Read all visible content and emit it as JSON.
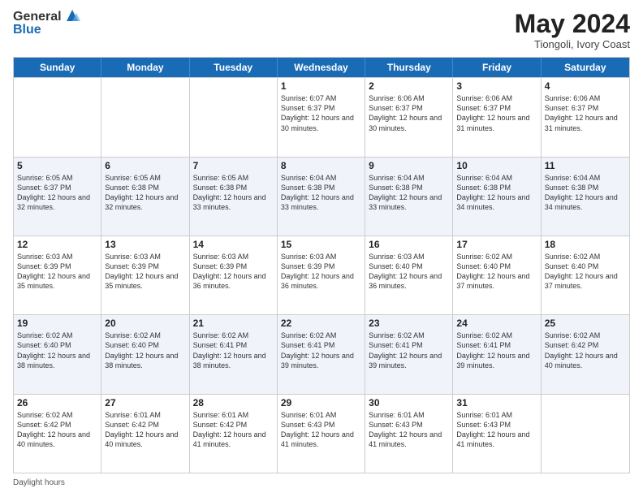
{
  "header": {
    "logo_general": "General",
    "logo_blue": "Blue",
    "month_year": "May 2024",
    "location": "Tiongoli, Ivory Coast"
  },
  "weekdays": [
    "Sunday",
    "Monday",
    "Tuesday",
    "Wednesday",
    "Thursday",
    "Friday",
    "Saturday"
  ],
  "rows": [
    [
      {
        "day": "",
        "sunrise": "",
        "sunset": "",
        "daylight": ""
      },
      {
        "day": "",
        "sunrise": "",
        "sunset": "",
        "daylight": ""
      },
      {
        "day": "",
        "sunrise": "",
        "sunset": "",
        "daylight": ""
      },
      {
        "day": "1",
        "sunrise": "Sunrise: 6:07 AM",
        "sunset": "Sunset: 6:37 PM",
        "daylight": "Daylight: 12 hours and 30 minutes."
      },
      {
        "day": "2",
        "sunrise": "Sunrise: 6:06 AM",
        "sunset": "Sunset: 6:37 PM",
        "daylight": "Daylight: 12 hours and 30 minutes."
      },
      {
        "day": "3",
        "sunrise": "Sunrise: 6:06 AM",
        "sunset": "Sunset: 6:37 PM",
        "daylight": "Daylight: 12 hours and 31 minutes."
      },
      {
        "day": "4",
        "sunrise": "Sunrise: 6:06 AM",
        "sunset": "Sunset: 6:37 PM",
        "daylight": "Daylight: 12 hours and 31 minutes."
      }
    ],
    [
      {
        "day": "5",
        "sunrise": "Sunrise: 6:05 AM",
        "sunset": "Sunset: 6:37 PM",
        "daylight": "Daylight: 12 hours and 32 minutes."
      },
      {
        "day": "6",
        "sunrise": "Sunrise: 6:05 AM",
        "sunset": "Sunset: 6:38 PM",
        "daylight": "Daylight: 12 hours and 32 minutes."
      },
      {
        "day": "7",
        "sunrise": "Sunrise: 6:05 AM",
        "sunset": "Sunset: 6:38 PM",
        "daylight": "Daylight: 12 hours and 33 minutes."
      },
      {
        "day": "8",
        "sunrise": "Sunrise: 6:04 AM",
        "sunset": "Sunset: 6:38 PM",
        "daylight": "Daylight: 12 hours and 33 minutes."
      },
      {
        "day": "9",
        "sunrise": "Sunrise: 6:04 AM",
        "sunset": "Sunset: 6:38 PM",
        "daylight": "Daylight: 12 hours and 33 minutes."
      },
      {
        "day": "10",
        "sunrise": "Sunrise: 6:04 AM",
        "sunset": "Sunset: 6:38 PM",
        "daylight": "Daylight: 12 hours and 34 minutes."
      },
      {
        "day": "11",
        "sunrise": "Sunrise: 6:04 AM",
        "sunset": "Sunset: 6:38 PM",
        "daylight": "Daylight: 12 hours and 34 minutes."
      }
    ],
    [
      {
        "day": "12",
        "sunrise": "Sunrise: 6:03 AM",
        "sunset": "Sunset: 6:39 PM",
        "daylight": "Daylight: 12 hours and 35 minutes."
      },
      {
        "day": "13",
        "sunrise": "Sunrise: 6:03 AM",
        "sunset": "Sunset: 6:39 PM",
        "daylight": "Daylight: 12 hours and 35 minutes."
      },
      {
        "day": "14",
        "sunrise": "Sunrise: 6:03 AM",
        "sunset": "Sunset: 6:39 PM",
        "daylight": "Daylight: 12 hours and 36 minutes."
      },
      {
        "day": "15",
        "sunrise": "Sunrise: 6:03 AM",
        "sunset": "Sunset: 6:39 PM",
        "daylight": "Daylight: 12 hours and 36 minutes."
      },
      {
        "day": "16",
        "sunrise": "Sunrise: 6:03 AM",
        "sunset": "Sunset: 6:40 PM",
        "daylight": "Daylight: 12 hours and 36 minutes."
      },
      {
        "day": "17",
        "sunrise": "Sunrise: 6:02 AM",
        "sunset": "Sunset: 6:40 PM",
        "daylight": "Daylight: 12 hours and 37 minutes."
      },
      {
        "day": "18",
        "sunrise": "Sunrise: 6:02 AM",
        "sunset": "Sunset: 6:40 PM",
        "daylight": "Daylight: 12 hours and 37 minutes."
      }
    ],
    [
      {
        "day": "19",
        "sunrise": "Sunrise: 6:02 AM",
        "sunset": "Sunset: 6:40 PM",
        "daylight": "Daylight: 12 hours and 38 minutes."
      },
      {
        "day": "20",
        "sunrise": "Sunrise: 6:02 AM",
        "sunset": "Sunset: 6:40 PM",
        "daylight": "Daylight: 12 hours and 38 minutes."
      },
      {
        "day": "21",
        "sunrise": "Sunrise: 6:02 AM",
        "sunset": "Sunset: 6:41 PM",
        "daylight": "Daylight: 12 hours and 38 minutes."
      },
      {
        "day": "22",
        "sunrise": "Sunrise: 6:02 AM",
        "sunset": "Sunset: 6:41 PM",
        "daylight": "Daylight: 12 hours and 39 minutes."
      },
      {
        "day": "23",
        "sunrise": "Sunrise: 6:02 AM",
        "sunset": "Sunset: 6:41 PM",
        "daylight": "Daylight: 12 hours and 39 minutes."
      },
      {
        "day": "24",
        "sunrise": "Sunrise: 6:02 AM",
        "sunset": "Sunset: 6:41 PM",
        "daylight": "Daylight: 12 hours and 39 minutes."
      },
      {
        "day": "25",
        "sunrise": "Sunrise: 6:02 AM",
        "sunset": "Sunset: 6:42 PM",
        "daylight": "Daylight: 12 hours and 40 minutes."
      }
    ],
    [
      {
        "day": "26",
        "sunrise": "Sunrise: 6:02 AM",
        "sunset": "Sunset: 6:42 PM",
        "daylight": "Daylight: 12 hours and 40 minutes."
      },
      {
        "day": "27",
        "sunrise": "Sunrise: 6:01 AM",
        "sunset": "Sunset: 6:42 PM",
        "daylight": "Daylight: 12 hours and 40 minutes."
      },
      {
        "day": "28",
        "sunrise": "Sunrise: 6:01 AM",
        "sunset": "Sunset: 6:42 PM",
        "daylight": "Daylight: 12 hours and 41 minutes."
      },
      {
        "day": "29",
        "sunrise": "Sunrise: 6:01 AM",
        "sunset": "Sunset: 6:43 PM",
        "daylight": "Daylight: 12 hours and 41 minutes."
      },
      {
        "day": "30",
        "sunrise": "Sunrise: 6:01 AM",
        "sunset": "Sunset: 6:43 PM",
        "daylight": "Daylight: 12 hours and 41 minutes."
      },
      {
        "day": "31",
        "sunrise": "Sunrise: 6:01 AM",
        "sunset": "Sunset: 6:43 PM",
        "daylight": "Daylight: 12 hours and 41 minutes."
      },
      {
        "day": "",
        "sunrise": "",
        "sunset": "",
        "daylight": ""
      }
    ]
  ],
  "footer": {
    "daylight_label": "Daylight hours"
  }
}
